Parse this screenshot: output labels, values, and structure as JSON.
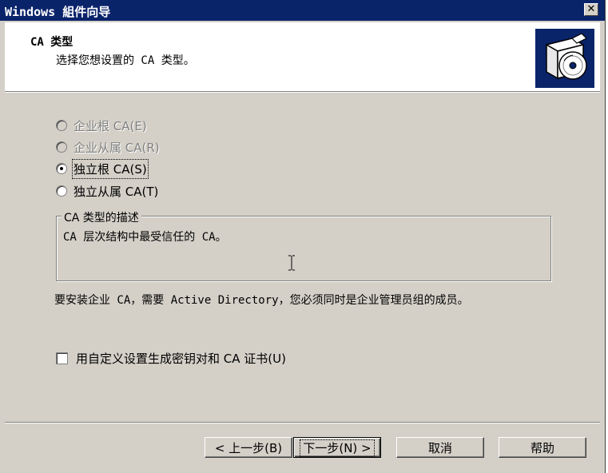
{
  "window": {
    "title": "Windows 組件向导",
    "close_symbol": "✕"
  },
  "header": {
    "title": "CA 类型",
    "subtitle": "选择您想设置的 CA 类型。",
    "logo_icon": "setup-disc-box-icon"
  },
  "ca_types": [
    {
      "label": "企业根 CA(E)",
      "selected": false,
      "enabled": false
    },
    {
      "label": "企业从属 CA(R)",
      "selected": false,
      "enabled": false
    },
    {
      "label": "独立根 CA(S)",
      "selected": true,
      "enabled": true
    },
    {
      "label": "独立从属 CA(T)",
      "selected": false,
      "enabled": true
    }
  ],
  "description": {
    "legend": "CA 类型的描述",
    "text": "CA 层次结构中最受信任的 CA。"
  },
  "note": "要安装企业 CA，需要 Active Directory，您必须同时是企业管理员组的成员。",
  "custom_settings": {
    "label": "用自定义设置生成密钥对和 CA 证书(U)",
    "checked": false
  },
  "buttons": {
    "back": "< 上一步(B)",
    "next": "下一步(N) >",
    "cancel": "取消",
    "help": "帮助"
  }
}
